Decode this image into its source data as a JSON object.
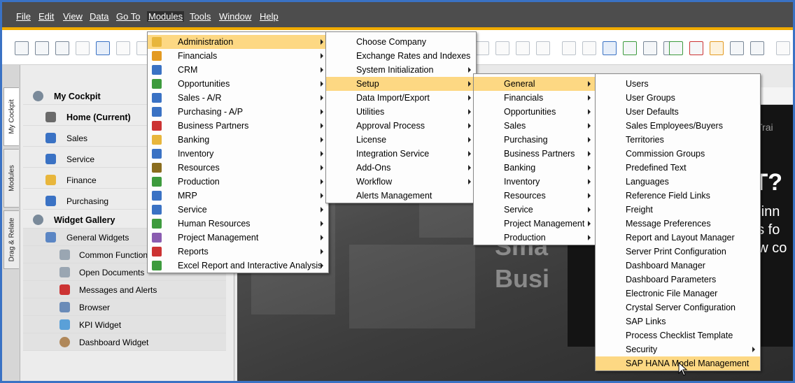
{
  "menubar": {
    "items": [
      {
        "label": "File"
      },
      {
        "label": "Edit"
      },
      {
        "label": "View"
      },
      {
        "label": "Data"
      },
      {
        "label": "Go To"
      },
      {
        "label": "Modules"
      },
      {
        "label": "Tools"
      },
      {
        "label": "Window"
      },
      {
        "label": "Help"
      }
    ]
  },
  "sidetabs": [
    {
      "label": "My Cockpit"
    },
    {
      "label": "Modules"
    },
    {
      "label": "Drag & Relate"
    }
  ],
  "cockpit": {
    "title": "My Cockpit",
    "home": "Home (Current)",
    "items": [
      {
        "label": "Sales"
      },
      {
        "label": "Service"
      },
      {
        "label": "Finance"
      },
      {
        "label": "Purchasing"
      }
    ],
    "widget_gallery": "Widget Gallery",
    "general_widgets": "General Widgets",
    "widgets": [
      {
        "label": "Common Functions"
      },
      {
        "label": "Open Documents"
      },
      {
        "label": "Messages and Alerts"
      },
      {
        "label": "Browser"
      },
      {
        "label": "KPI Widget"
      },
      {
        "label": "Dashboard Widget"
      }
    ]
  },
  "hero": {
    "tab_text": "Trai",
    "line1": "IT?",
    "line2": "ve inn",
    "line3": "ays fo",
    "line4": "now co",
    "big1": "Sma",
    "big2": "Busi"
  },
  "modules_menu": {
    "items": [
      {
        "label": "Administration",
        "icon": "administration-icon",
        "color": "#e8b63c"
      },
      {
        "label": "Financials",
        "icon": "financials-icon",
        "color": "#e39a21"
      },
      {
        "label": "CRM",
        "icon": "crm-icon",
        "color": "#3a72c4"
      },
      {
        "label": "Opportunities",
        "icon": "opportunities-icon",
        "color": "#3d9b3d"
      },
      {
        "label": "Sales - A/R",
        "icon": "sales-icon",
        "color": "#3a72c4"
      },
      {
        "label": "Purchasing - A/P",
        "icon": "purchasing-icon",
        "color": "#3a72c4"
      },
      {
        "label": "Business Partners",
        "icon": "business-partners-icon",
        "color": "#c33"
      },
      {
        "label": "Banking",
        "icon": "banking-icon",
        "color": "#e8b63c"
      },
      {
        "label": "Inventory",
        "icon": "inventory-icon",
        "color": "#3a72c4"
      },
      {
        "label": "Resources",
        "icon": "resources-icon",
        "color": "#8a6d1e"
      },
      {
        "label": "Production",
        "icon": "production-icon",
        "color": "#3d9b3d"
      },
      {
        "label": "MRP",
        "icon": "mrp-icon",
        "color": "#3a72c4"
      },
      {
        "label": "Service",
        "icon": "service-icon",
        "color": "#3a72c4"
      },
      {
        "label": "Human Resources",
        "icon": "human-resources-icon",
        "color": "#3d9b3d"
      },
      {
        "label": "Project Management",
        "icon": "project-management-icon",
        "color": "#8a5cb0"
      },
      {
        "label": "Reports",
        "icon": "reports-icon",
        "color": "#c33"
      },
      {
        "label": "Excel Report and Interactive Analysis",
        "icon": "excel-report-icon",
        "color": "#3d9b3d"
      }
    ],
    "highlighted": "Administration"
  },
  "administration_menu": {
    "items": [
      {
        "label": "Choose Company",
        "submenu": false
      },
      {
        "label": "Exchange Rates and Indexes",
        "submenu": false
      },
      {
        "label": "System Initialization",
        "submenu": true
      },
      {
        "label": "Setup",
        "submenu": true
      },
      {
        "label": "Data Import/Export",
        "submenu": true
      },
      {
        "label": "Utilities",
        "submenu": true
      },
      {
        "label": "Approval Process",
        "submenu": true
      },
      {
        "label": "License",
        "submenu": true
      },
      {
        "label": "Integration Service",
        "submenu": true
      },
      {
        "label": "Add-Ons",
        "submenu": true
      },
      {
        "label": "Workflow",
        "submenu": true
      },
      {
        "label": "Alerts Management",
        "submenu": false
      }
    ],
    "highlighted": "Setup"
  },
  "setup_menu": {
    "items": [
      {
        "label": "General"
      },
      {
        "label": "Financials"
      },
      {
        "label": "Opportunities"
      },
      {
        "label": "Sales"
      },
      {
        "label": "Purchasing"
      },
      {
        "label": "Business Partners"
      },
      {
        "label": "Banking"
      },
      {
        "label": "Inventory"
      },
      {
        "label": "Resources"
      },
      {
        "label": "Service"
      },
      {
        "label": "Project Management"
      },
      {
        "label": "Production"
      }
    ],
    "highlighted": "General"
  },
  "general_menu": {
    "items": [
      {
        "label": "Users",
        "submenu": false
      },
      {
        "label": "User Groups",
        "submenu": false
      },
      {
        "label": "User Defaults",
        "submenu": false
      },
      {
        "label": "Sales Employees/Buyers",
        "submenu": false
      },
      {
        "label": "Territories",
        "submenu": false
      },
      {
        "label": "Commission Groups",
        "submenu": false
      },
      {
        "label": "Predefined Text",
        "submenu": false
      },
      {
        "label": "Languages",
        "submenu": false
      },
      {
        "label": "Reference Field Links",
        "submenu": false
      },
      {
        "label": "Freight",
        "submenu": false
      },
      {
        "label": "Message Preferences",
        "submenu": false
      },
      {
        "label": "Report and Layout Manager",
        "submenu": false
      },
      {
        "label": "Server Print Configuration",
        "submenu": false
      },
      {
        "label": "Dashboard Manager",
        "submenu": false
      },
      {
        "label": "Dashboard Parameters",
        "submenu": false
      },
      {
        "label": "Electronic File Manager",
        "submenu": false
      },
      {
        "label": "Crystal Server Configuration",
        "submenu": false
      },
      {
        "label": "SAP Links",
        "submenu": false
      },
      {
        "label": "Process Checklist Template",
        "submenu": false
      },
      {
        "label": "Security",
        "submenu": true
      },
      {
        "label": "SAP HANA Model Management",
        "submenu": false
      }
    ],
    "highlighted": "SAP HANA Model Management"
  },
  "colors": {
    "menubar_bg": "#4d4d4d",
    "accent_bar": "#f0ab00",
    "menu_highlight": "#fdd883",
    "window_border": "#3a72c4"
  }
}
